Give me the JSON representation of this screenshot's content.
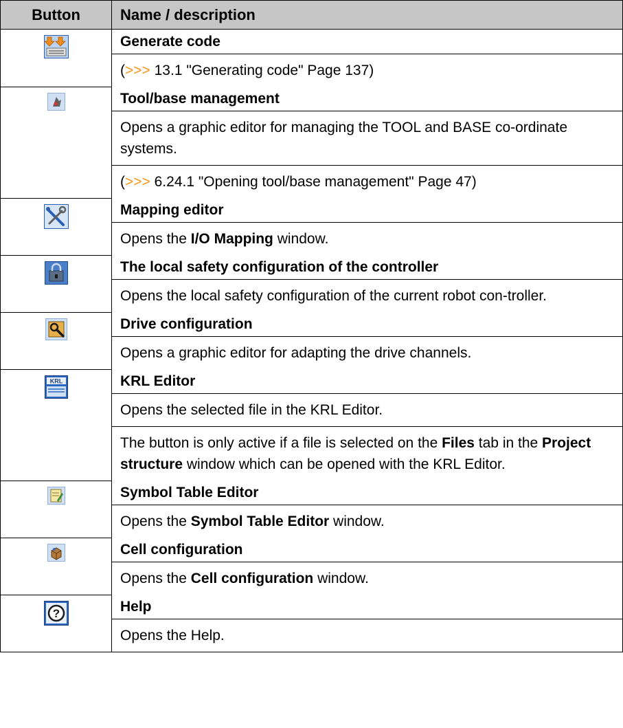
{
  "header": {
    "button": "Button",
    "name": "Name / description"
  },
  "rows": [
    {
      "icon": "generate-code-icon",
      "title": "Generate code",
      "paras": [
        {
          "prefix": "(",
          "arrows": ">>>",
          "ref": " 13.1 \"Generating code\" Page 137)"
        }
      ]
    },
    {
      "icon": "tool-base-icon",
      "title": "Tool/base management",
      "paras": [
        {
          "text": "Opens a graphic editor for managing the TOOL and BASE co-ordinate systems."
        },
        {
          "prefix": "(",
          "arrows": ">>>",
          "ref": " 6.24.1 \"Opening tool/base management\" Page 47)"
        }
      ]
    },
    {
      "icon": "mapping-editor-icon",
      "title": "Mapping editor",
      "paras": [
        {
          "t1": "Opens the ",
          "b1": "I/O Mapping",
          "t2": " window."
        }
      ]
    },
    {
      "icon": "safety-config-icon",
      "title": "The local safety configuration of the controller",
      "paras": [
        {
          "text": "Opens the local safety configuration of the current robot con-troller."
        }
      ]
    },
    {
      "icon": "drive-config-icon",
      "title": "Drive configuration",
      "paras": [
        {
          "text": "Opens a graphic editor for adapting the drive channels."
        }
      ]
    },
    {
      "icon": "krl-editor-icon",
      "icon_text": "KRL",
      "title": "KRL Editor",
      "paras": [
        {
          "text": "Opens the selected file in the KRL Editor."
        },
        {
          "t1": "The button is only active if a file is selected on the ",
          "b1": "Files",
          "t2": " tab in the ",
          "b2": "Project structure",
          "t3": " window which can be opened with the KRL Editor."
        }
      ]
    },
    {
      "icon": "symbol-table-icon",
      "title": "Symbol Table Editor",
      "paras": [
        {
          "t1": "Opens the ",
          "b1": "Symbol Table Editor",
          "t2": " window."
        }
      ]
    },
    {
      "icon": "cell-config-icon",
      "title": "Cell configuration",
      "paras": [
        {
          "t1": "Opens the ",
          "b1": "Cell configuration",
          "t2": " window."
        }
      ]
    },
    {
      "icon": "help-icon",
      "icon_text": "?",
      "title": "Help",
      "paras": [
        {
          "text": "Opens the Help."
        }
      ]
    }
  ]
}
